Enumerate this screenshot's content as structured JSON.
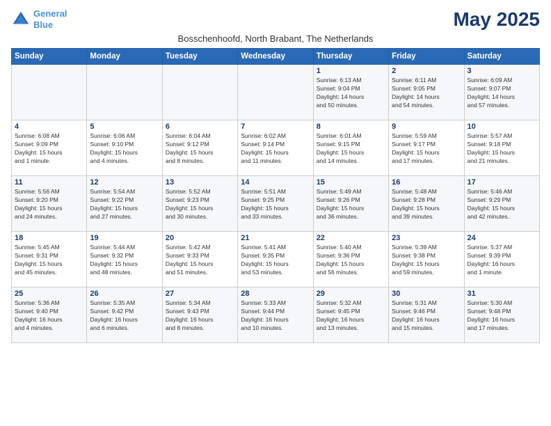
{
  "logo": {
    "line1": "General",
    "line2": "Blue"
  },
  "title": "May 2025",
  "location": "Bosschenhoofd, North Brabant, The Netherlands",
  "weekdays": [
    "Sunday",
    "Monday",
    "Tuesday",
    "Wednesday",
    "Thursday",
    "Friday",
    "Saturday"
  ],
  "weeks": [
    [
      {
        "day": "",
        "info": ""
      },
      {
        "day": "",
        "info": ""
      },
      {
        "day": "",
        "info": ""
      },
      {
        "day": "",
        "info": ""
      },
      {
        "day": "1",
        "info": "Sunrise: 6:13 AM\nSunset: 9:04 PM\nDaylight: 14 hours\nand 50 minutes."
      },
      {
        "day": "2",
        "info": "Sunrise: 6:11 AM\nSunset: 9:05 PM\nDaylight: 14 hours\nand 54 minutes."
      },
      {
        "day": "3",
        "info": "Sunrise: 6:09 AM\nSunset: 9:07 PM\nDaylight: 14 hours\nand 57 minutes."
      }
    ],
    [
      {
        "day": "4",
        "info": "Sunrise: 6:08 AM\nSunset: 9:09 PM\nDaylight: 15 hours\nand 1 minute."
      },
      {
        "day": "5",
        "info": "Sunrise: 6:06 AM\nSunset: 9:10 PM\nDaylight: 15 hours\nand 4 minutes."
      },
      {
        "day": "6",
        "info": "Sunrise: 6:04 AM\nSunset: 9:12 PM\nDaylight: 15 hours\nand 8 minutes."
      },
      {
        "day": "7",
        "info": "Sunrise: 6:02 AM\nSunset: 9:14 PM\nDaylight: 15 hours\nand 11 minutes."
      },
      {
        "day": "8",
        "info": "Sunrise: 6:01 AM\nSunset: 9:15 PM\nDaylight: 15 hours\nand 14 minutes."
      },
      {
        "day": "9",
        "info": "Sunrise: 5:59 AM\nSunset: 9:17 PM\nDaylight: 15 hours\nand 17 minutes."
      },
      {
        "day": "10",
        "info": "Sunrise: 5:57 AM\nSunset: 9:18 PM\nDaylight: 15 hours\nand 21 minutes."
      }
    ],
    [
      {
        "day": "11",
        "info": "Sunrise: 5:56 AM\nSunset: 9:20 PM\nDaylight: 15 hours\nand 24 minutes."
      },
      {
        "day": "12",
        "info": "Sunrise: 5:54 AM\nSunset: 9:22 PM\nDaylight: 15 hours\nand 27 minutes."
      },
      {
        "day": "13",
        "info": "Sunrise: 5:52 AM\nSunset: 9:23 PM\nDaylight: 15 hours\nand 30 minutes."
      },
      {
        "day": "14",
        "info": "Sunrise: 5:51 AM\nSunset: 9:25 PM\nDaylight: 15 hours\nand 33 minutes."
      },
      {
        "day": "15",
        "info": "Sunrise: 5:49 AM\nSunset: 9:26 PM\nDaylight: 15 hours\nand 36 minutes."
      },
      {
        "day": "16",
        "info": "Sunrise: 5:48 AM\nSunset: 9:28 PM\nDaylight: 15 hours\nand 39 minutes."
      },
      {
        "day": "17",
        "info": "Sunrise: 5:46 AM\nSunset: 9:29 PM\nDaylight: 15 hours\nand 42 minutes."
      }
    ],
    [
      {
        "day": "18",
        "info": "Sunrise: 5:45 AM\nSunset: 9:31 PM\nDaylight: 15 hours\nand 45 minutes."
      },
      {
        "day": "19",
        "info": "Sunrise: 5:44 AM\nSunset: 9:32 PM\nDaylight: 15 hours\nand 48 minutes."
      },
      {
        "day": "20",
        "info": "Sunrise: 5:42 AM\nSunset: 9:33 PM\nDaylight: 15 hours\nand 51 minutes."
      },
      {
        "day": "21",
        "info": "Sunrise: 5:41 AM\nSunset: 9:35 PM\nDaylight: 15 hours\nand 53 minutes."
      },
      {
        "day": "22",
        "info": "Sunrise: 5:40 AM\nSunset: 9:36 PM\nDaylight: 15 hours\nand 56 minutes."
      },
      {
        "day": "23",
        "info": "Sunrise: 5:39 AM\nSunset: 9:38 PM\nDaylight: 15 hours\nand 59 minutes."
      },
      {
        "day": "24",
        "info": "Sunrise: 5:37 AM\nSunset: 9:39 PM\nDaylight: 16 hours\nand 1 minute."
      }
    ],
    [
      {
        "day": "25",
        "info": "Sunrise: 5:36 AM\nSunset: 9:40 PM\nDaylight: 16 hours\nand 4 minutes."
      },
      {
        "day": "26",
        "info": "Sunrise: 5:35 AM\nSunset: 9:42 PM\nDaylight: 16 hours\nand 6 minutes."
      },
      {
        "day": "27",
        "info": "Sunrise: 5:34 AM\nSunset: 9:43 PM\nDaylight: 16 hours\nand 8 minutes."
      },
      {
        "day": "28",
        "info": "Sunrise: 5:33 AM\nSunset: 9:44 PM\nDaylight: 16 hours\nand 10 minutes."
      },
      {
        "day": "29",
        "info": "Sunrise: 5:32 AM\nSunset: 9:45 PM\nDaylight: 16 hours\nand 13 minutes."
      },
      {
        "day": "30",
        "info": "Sunrise: 5:31 AM\nSunset: 9:46 PM\nDaylight: 16 hours\nand 15 minutes."
      },
      {
        "day": "31",
        "info": "Sunrise: 5:30 AM\nSunset: 9:48 PM\nDaylight: 16 hours\nand 17 minutes."
      }
    ]
  ]
}
